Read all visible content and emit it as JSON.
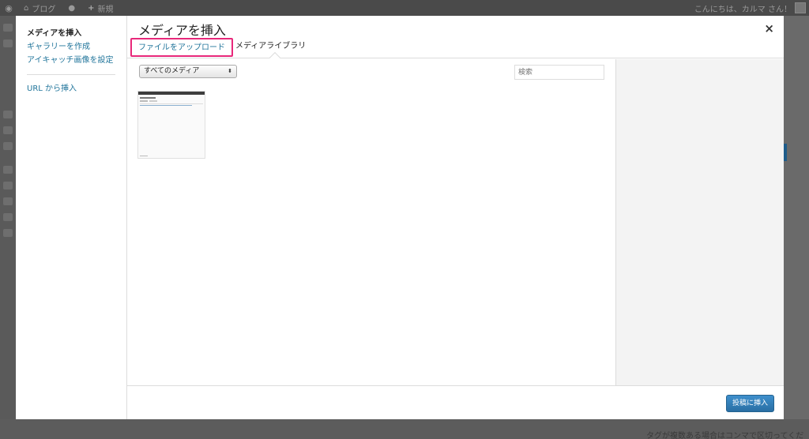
{
  "adminbar": {
    "site_name": "ブログ",
    "comments_icon": "speech-bubble-icon",
    "new_label": "新規",
    "greeting": "こんにちは、カルマ さん！"
  },
  "modal": {
    "title": "メディアを挿入",
    "close_label": "×",
    "menu": {
      "items": [
        {
          "label": "メディアを挿入",
          "active": true
        },
        {
          "label": "ギャラリーを作成",
          "active": false
        },
        {
          "label": "アイキャッチ画像を設定",
          "active": false
        }
      ],
      "url_insert": "URL から挿入"
    },
    "tabs": {
      "upload": "ファイルをアップロード",
      "library": "メディアライブラリ"
    },
    "filter": {
      "selected": "すべてのメディア"
    },
    "search": {
      "placeholder": "検索"
    },
    "toolbar": {
      "insert_label": "投稿に挿入"
    }
  },
  "background": {
    "bottom_hint": "タグが複数ある場合はコンマで区切ってください"
  },
  "colors": {
    "link": "#21759b",
    "highlight": "#e8287a",
    "primary_button": "#2a6fa4"
  }
}
